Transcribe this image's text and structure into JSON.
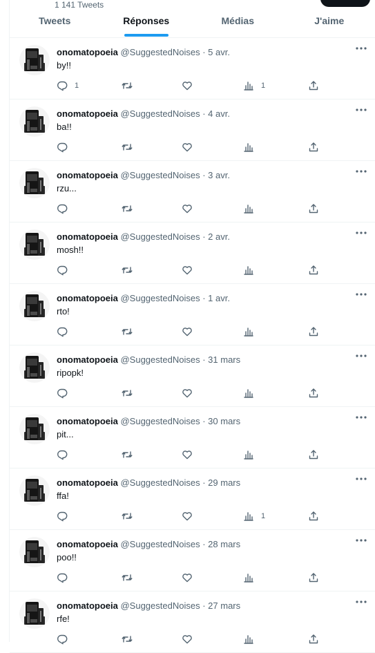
{
  "profile": {
    "tweet_count": "1 141 Tweets"
  },
  "tabs": [
    {
      "label": "Tweets",
      "active": false
    },
    {
      "label": "Réponses",
      "active": true
    },
    {
      "label": "Médias",
      "active": false
    },
    {
      "label": "J'aime",
      "active": false
    }
  ],
  "colors": {
    "accent": "#1d9bf0",
    "text": "#0f1419",
    "muted": "#536471",
    "border": "#eff3f4"
  },
  "icons": {
    "reply": "reply-icon",
    "retweet": "retweet-icon",
    "like": "heart-icon",
    "views": "views-icon",
    "share": "share-icon",
    "more": "more-icon"
  },
  "tweets": [
    {
      "name": "onomatopoeia",
      "handle": "@SuggestedNoises",
      "sep": "·",
      "date": "5 avr.",
      "text": "by!!",
      "replies": "1",
      "retweets": "",
      "likes": "",
      "views": "1"
    },
    {
      "name": "onomatopoeia",
      "handle": "@SuggestedNoises",
      "sep": "·",
      "date": "4 avr.",
      "text": "ba!!",
      "replies": "",
      "retweets": "",
      "likes": "",
      "views": ""
    },
    {
      "name": "onomatopoeia",
      "handle": "@SuggestedNoises",
      "sep": "·",
      "date": "3 avr.",
      "text": "rzu...",
      "replies": "",
      "retweets": "",
      "likes": "",
      "views": ""
    },
    {
      "name": "onomatopoeia",
      "handle": "@SuggestedNoises",
      "sep": "·",
      "date": "2 avr.",
      "text": "mosh!!",
      "replies": "",
      "retweets": "",
      "likes": "",
      "views": ""
    },
    {
      "name": "onomatopoeia",
      "handle": "@SuggestedNoises",
      "sep": "·",
      "date": "1 avr.",
      "text": "rto!",
      "replies": "",
      "retweets": "",
      "likes": "",
      "views": ""
    },
    {
      "name": "onomatopoeia",
      "handle": "@SuggestedNoises",
      "sep": "·",
      "date": "31 mars",
      "text": "ripopk!",
      "replies": "",
      "retweets": "",
      "likes": "",
      "views": ""
    },
    {
      "name": "onomatopoeia",
      "handle": "@SuggestedNoises",
      "sep": "·",
      "date": "30 mars",
      "text": "pit...",
      "replies": "",
      "retweets": "",
      "likes": "",
      "views": ""
    },
    {
      "name": "onomatopoeia",
      "handle": "@SuggestedNoises",
      "sep": "·",
      "date": "29 mars",
      "text": "ffa!",
      "replies": "",
      "retweets": "",
      "likes": "",
      "views": "1"
    },
    {
      "name": "onomatopoeia",
      "handle": "@SuggestedNoises",
      "sep": "·",
      "date": "28 mars",
      "text": "poo!!",
      "replies": "",
      "retweets": "",
      "likes": "",
      "views": ""
    },
    {
      "name": "onomatopoeia",
      "handle": "@SuggestedNoises",
      "sep": "·",
      "date": "27 mars",
      "text": "rfe!",
      "replies": "",
      "retweets": "",
      "likes": "",
      "views": ""
    }
  ]
}
